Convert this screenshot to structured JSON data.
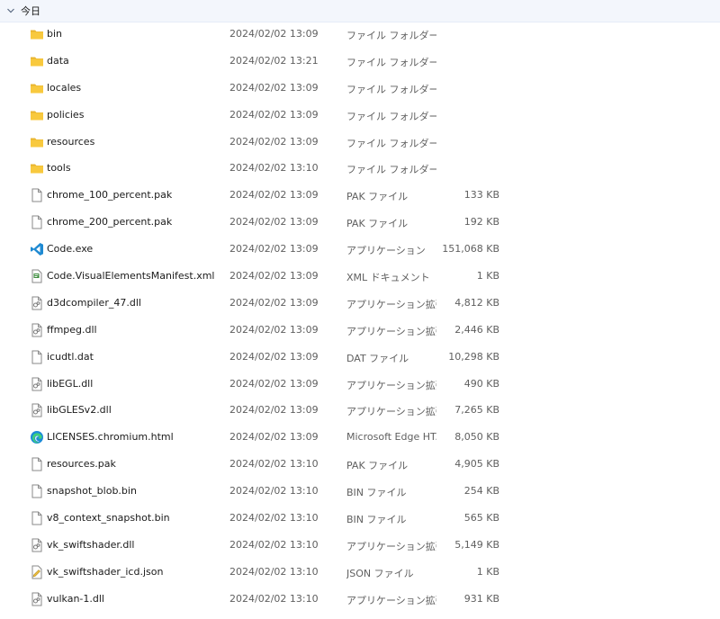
{
  "group": {
    "label": "今日"
  },
  "files": [
    {
      "name": "bin",
      "date": "2024/02/02 13:09",
      "type": "ファイル フォルダー",
      "size": "",
      "icon": "folder-icon"
    },
    {
      "name": "data",
      "date": "2024/02/02 13:21",
      "type": "ファイル フォルダー",
      "size": "",
      "icon": "folder-icon"
    },
    {
      "name": "locales",
      "date": "2024/02/02 13:09",
      "type": "ファイル フォルダー",
      "size": "",
      "icon": "folder-icon"
    },
    {
      "name": "policies",
      "date": "2024/02/02 13:09",
      "type": "ファイル フォルダー",
      "size": "",
      "icon": "folder-icon"
    },
    {
      "name": "resources",
      "date": "2024/02/02 13:09",
      "type": "ファイル フォルダー",
      "size": "",
      "icon": "folder-icon"
    },
    {
      "name": "tools",
      "date": "2024/02/02 13:10",
      "type": "ファイル フォルダー",
      "size": "",
      "icon": "folder-icon"
    },
    {
      "name": "chrome_100_percent.pak",
      "date": "2024/02/02 13:09",
      "type": "PAK ファイル",
      "size": "133 KB",
      "icon": "file-icon"
    },
    {
      "name": "chrome_200_percent.pak",
      "date": "2024/02/02 13:09",
      "type": "PAK ファイル",
      "size": "192 KB",
      "icon": "file-icon"
    },
    {
      "name": "Code.exe",
      "date": "2024/02/02 13:09",
      "type": "アプリケーション",
      "size": "151,068 KB",
      "icon": "vscode-icon"
    },
    {
      "name": "Code.VisualElementsManifest.xml",
      "date": "2024/02/02 13:09",
      "type": "XML ドキュメント",
      "size": "1 KB",
      "icon": "xml-file-icon"
    },
    {
      "name": "d3dcompiler_47.dll",
      "date": "2024/02/02 13:09",
      "type": "アプリケーション拡張",
      "size": "4,812 KB",
      "icon": "dll-file-icon"
    },
    {
      "name": "ffmpeg.dll",
      "date": "2024/02/02 13:09",
      "type": "アプリケーション拡張",
      "size": "2,446 KB",
      "icon": "dll-file-icon"
    },
    {
      "name": "icudtl.dat",
      "date": "2024/02/02 13:09",
      "type": "DAT ファイル",
      "size": "10,298 KB",
      "icon": "file-icon"
    },
    {
      "name": "libEGL.dll",
      "date": "2024/02/02 13:09",
      "type": "アプリケーション拡張",
      "size": "490 KB",
      "icon": "dll-file-icon"
    },
    {
      "name": "libGLESv2.dll",
      "date": "2024/02/02 13:09",
      "type": "アプリケーション拡張",
      "size": "7,265 KB",
      "icon": "dll-file-icon"
    },
    {
      "name": "LICENSES.chromium.html",
      "date": "2024/02/02 13:09",
      "type": "Microsoft Edge HT...",
      "size": "8,050 KB",
      "icon": "edge-icon"
    },
    {
      "name": "resources.pak",
      "date": "2024/02/02 13:10",
      "type": "PAK ファイル",
      "size": "4,905 KB",
      "icon": "file-icon"
    },
    {
      "name": "snapshot_blob.bin",
      "date": "2024/02/02 13:10",
      "type": "BIN ファイル",
      "size": "254 KB",
      "icon": "file-icon"
    },
    {
      "name": "v8_context_snapshot.bin",
      "date": "2024/02/02 13:10",
      "type": "BIN ファイル",
      "size": "565 KB",
      "icon": "file-icon"
    },
    {
      "name": "vk_swiftshader.dll",
      "date": "2024/02/02 13:10",
      "type": "アプリケーション拡張",
      "size": "5,149 KB",
      "icon": "dll-file-icon"
    },
    {
      "name": "vk_swiftshader_icd.json",
      "date": "2024/02/02 13:10",
      "type": "JSON ファイル",
      "size": "1 KB",
      "icon": "json-file-icon"
    },
    {
      "name": "vulkan-1.dll",
      "date": "2024/02/02 13:10",
      "type": "アプリケーション拡張",
      "size": "931 KB",
      "icon": "dll-file-icon"
    }
  ]
}
